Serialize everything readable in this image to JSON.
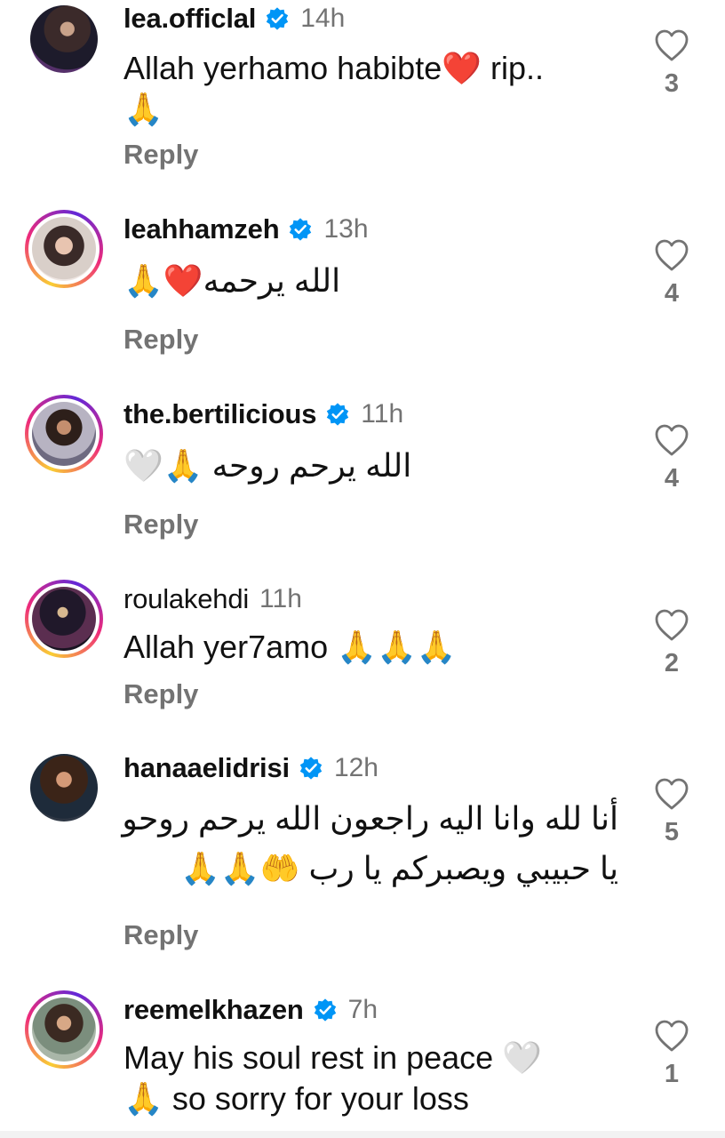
{
  "comments": [
    {
      "username": "lea.officlal",
      "verified": true,
      "time": "14h",
      "lines": [
        "Allah yerhamo habibte❤️ rip..",
        "🙏"
      ],
      "reply": "Reply",
      "likes": "3"
    },
    {
      "username": "leahhamzeh",
      "verified": true,
      "time": "13h",
      "lines": [
        "الله يرحمه❤️🙏"
      ],
      "reply": "Reply",
      "likes": "4"
    },
    {
      "username": "the.bertilicious",
      "verified": true,
      "time": "11h",
      "lines": [
        "الله يرحم روحه 🙏🤍"
      ],
      "reply": "Reply",
      "likes": "4"
    },
    {
      "username": "roulakehdi",
      "verified": false,
      "time": "11h",
      "lines": [
        "Allah yer7amo 🙏🙏🙏"
      ],
      "reply": "Reply",
      "likes": "2"
    },
    {
      "username": "hanaaelidrisi",
      "verified": true,
      "time": "12h",
      "lines": [
        "أنا لله وانا اليه راجعون الله يرحم روحو",
        "يا حبيبي ويصبركم يا رب 🤲🙏🙏"
      ],
      "reply": "Reply",
      "likes": "5"
    },
    {
      "username": "reemelkhazen",
      "verified": true,
      "time": "7h",
      "lines": [
        "May his soul rest in peace 🤍",
        "🙏 so sorry for your loss"
      ],
      "reply": "Reply",
      "likes": "1"
    }
  ],
  "colors": {
    "verified": "#0095f6",
    "muted": "#737373",
    "text": "#111111"
  }
}
